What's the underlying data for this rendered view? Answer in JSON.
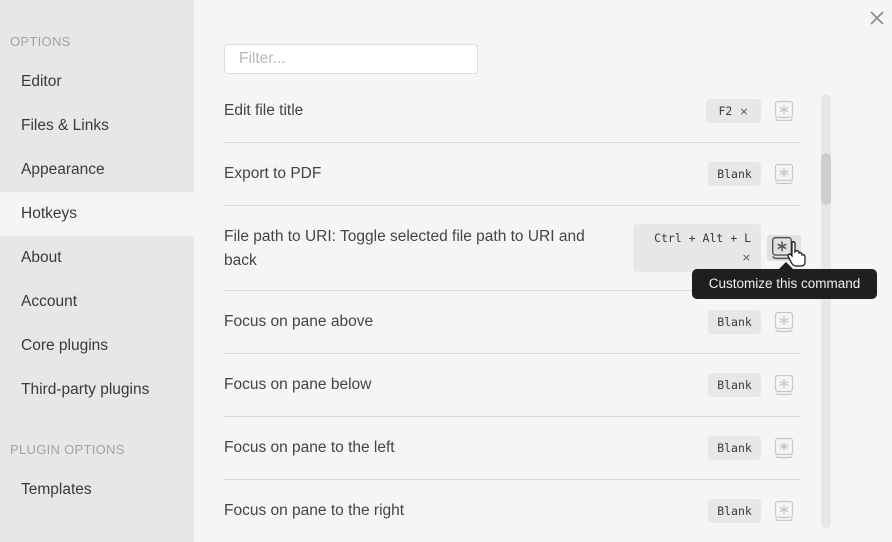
{
  "sidebar": {
    "sections": [
      {
        "title": "OPTIONS",
        "items": [
          {
            "label": "Editor",
            "active": false
          },
          {
            "label": "Files & Links",
            "active": false
          },
          {
            "label": "Appearance",
            "active": false
          },
          {
            "label": "Hotkeys",
            "active": true
          },
          {
            "label": "About",
            "active": false
          },
          {
            "label": "Account",
            "active": false
          },
          {
            "label": "Core plugins",
            "active": false
          },
          {
            "label": "Third-party plugins",
            "active": false
          }
        ]
      },
      {
        "title": "PLUGIN OPTIONS",
        "items": [
          {
            "label": "Templates",
            "active": false
          }
        ]
      }
    ]
  },
  "filter": {
    "placeholder": "Filter...",
    "value": ""
  },
  "close_icon": "close-icon",
  "hotkeys": [
    {
      "name": "Edit file title",
      "hotkey": "F2",
      "removable": true
    },
    {
      "name": "Export to PDF",
      "hotkey": "Blank",
      "removable": false
    },
    {
      "name": "File path to URI: Toggle selected file path to URI and back",
      "hotkey": "Ctrl + Alt + L",
      "removable": true
    },
    {
      "name": "Focus on pane above",
      "hotkey": "Blank",
      "removable": false
    },
    {
      "name": "Focus on pane below",
      "hotkey": "Blank",
      "removable": false
    },
    {
      "name": "Focus on pane to the left",
      "hotkey": "Blank",
      "removable": false
    },
    {
      "name": "Focus on pane to the right",
      "hotkey": "Blank",
      "removable": false
    }
  ],
  "remove_glyph": "×",
  "tooltip": {
    "text": "Customize this command"
  },
  "scrollbar": {
    "position_fraction": 0.14
  }
}
